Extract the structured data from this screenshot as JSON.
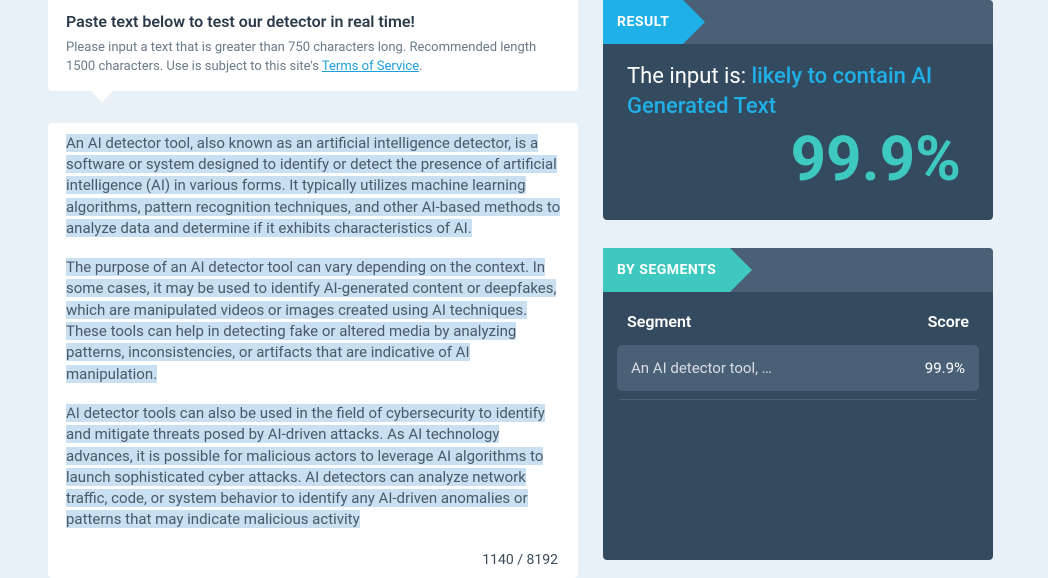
{
  "header": {
    "title": "Paste text below to test our detector in real time!",
    "sub_before": "Please input a text that is greater than 750 characters long. Recommended length 1500 characters. Use is subject to this site's ",
    "tos": "Terms of Service",
    "sub_after": "."
  },
  "input": {
    "p1": "An AI detector tool, also known as an artificial intelligence detector, is a software or system designed to identify or detect the presence of artificial intelligence (AI) in various forms. It typically utilizes machine learning algorithms, pattern recognition techniques, and other AI-based methods to analyze data and determine if it exhibits characteristics of AI.",
    "p2": "The purpose of an AI detector tool can vary depending on the context. In some cases, it may be used to identify AI-generated content or deepfakes, which are manipulated videos or images created using AI techniques. These tools can help in detecting fake or altered media by analyzing patterns, inconsistencies, or artifacts that are indicative of AI manipulation.",
    "p3": "AI detector tools can also be used in the field of cybersecurity to identify and mitigate threats posed by AI-driven attacks. As AI technology advances, it is possible for malicious actors to leverage AI algorithms to launch sophisticated cyber attacks. AI detectors can analyze network traffic, code, or system behavior to identify any AI-driven anomalies or patterns that may indicate malicious activity",
    "count_current": "1140",
    "count_max": "8192"
  },
  "result": {
    "badge": "RESULT",
    "prefix": "The input is: ",
    "verdict": "likely to contain AI Generated Text",
    "percent": "99.9%"
  },
  "segments": {
    "badge": "BY SEGMENTS",
    "col_segment": "Segment",
    "col_score": "Score",
    "rows": [
      {
        "label": "An AI detector tool, …",
        "score": "99.9%"
      }
    ]
  }
}
